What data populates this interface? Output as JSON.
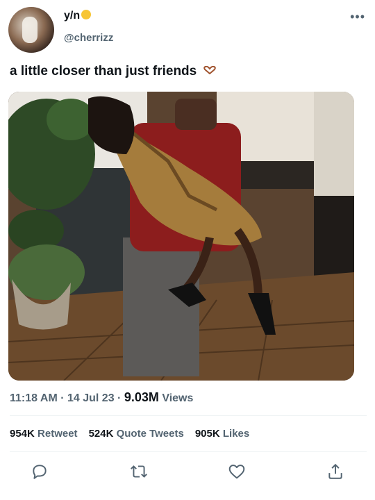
{
  "user": {
    "display_name": "y/n",
    "handle": "@cherrizz"
  },
  "more_label": "•••",
  "tweet": {
    "text": "a little closer than just friends"
  },
  "meta": {
    "time": "11:18 AM",
    "sep1": " · ",
    "date": "14 Jul 23",
    "sep2": " · ",
    "views_count": "9.03M",
    "views_label": "Views"
  },
  "stats": {
    "retweets_count": "954K",
    "retweets_label": "Retweet",
    "quotes_count": "524K",
    "quotes_label": "Quote Tweets",
    "likes_count": "905K",
    "likes_label": "Likes"
  },
  "colors": {
    "secondary_text": "#536471",
    "divider": "#eff3f4",
    "icon": "#536471"
  },
  "icons": [
    "reply-icon",
    "retweet-icon",
    "like-icon",
    "share-icon"
  ]
}
